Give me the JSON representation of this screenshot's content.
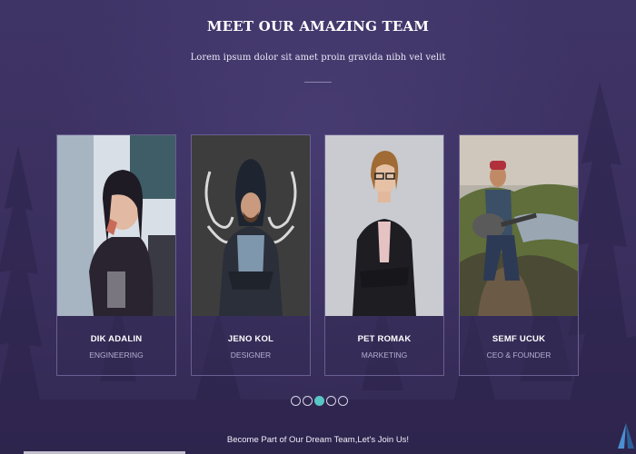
{
  "section": {
    "title": "MEET OUR AMAZING TEAM",
    "subtitle": "Lorem ipsum dolor sit amet proin gravida nibh vel velit"
  },
  "team": [
    {
      "name": "DIK ADALIN",
      "role": "ENGINEERING"
    },
    {
      "name": "JENO KOL",
      "role": "DESIGNER"
    },
    {
      "name": "PET ROMAK",
      "role": "MARKETING"
    },
    {
      "name": "SEMF UCUK",
      "role": "CEO & FOUNDER"
    }
  ],
  "carousel": {
    "active_index": 2,
    "total": 5
  },
  "footer": {
    "cta": "Become Part of Our Dream Team,Let's Join Us!"
  },
  "colors": {
    "background": "#3a2f5e",
    "accent": "#58c6c5",
    "card_border": "#6a5f91"
  }
}
